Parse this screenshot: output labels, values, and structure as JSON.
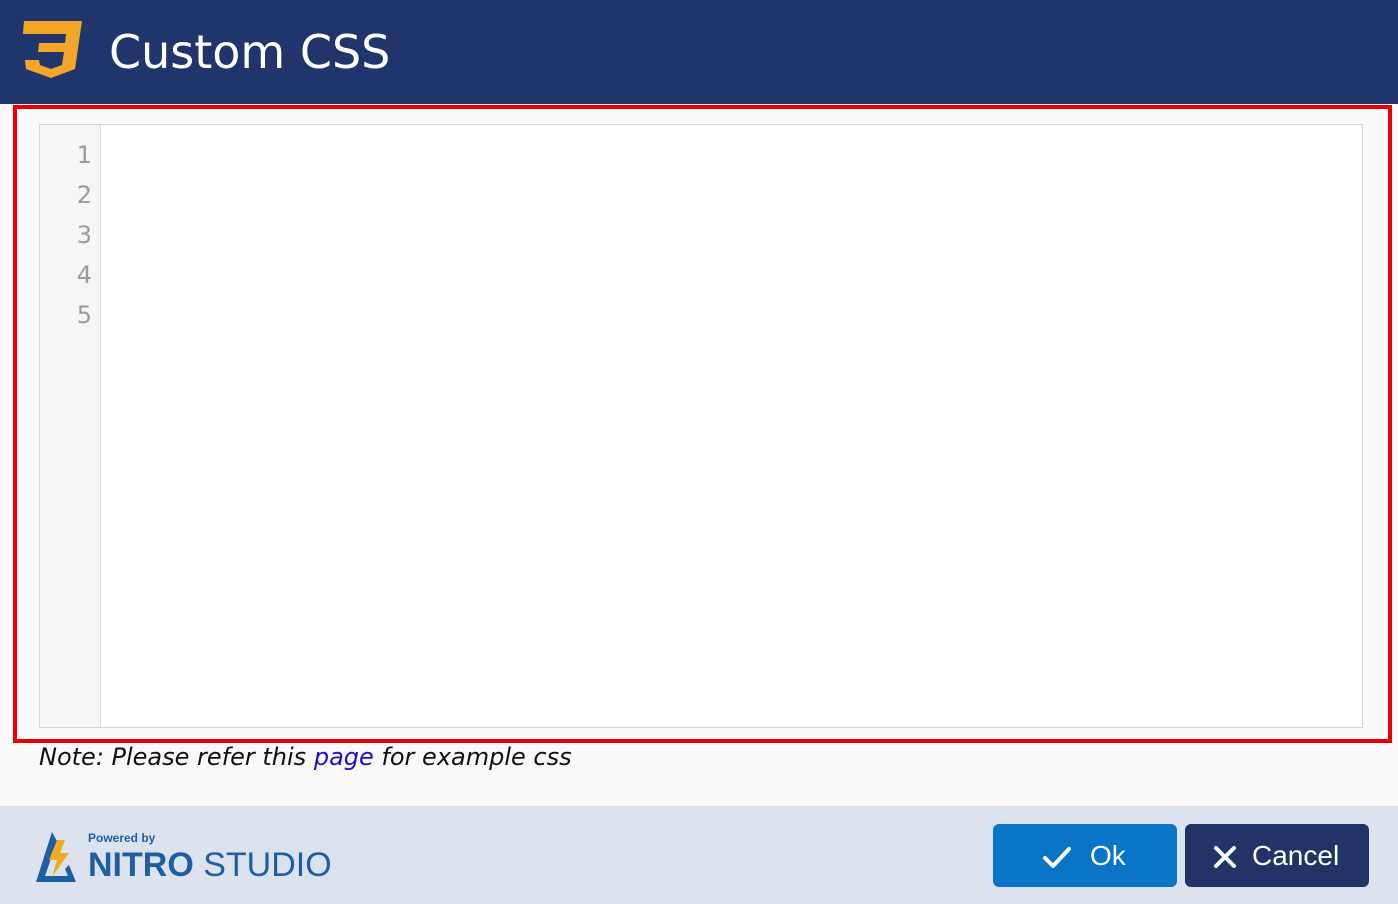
{
  "dialog": {
    "title": "Custom CSS",
    "icon": "css3-icon"
  },
  "editor": {
    "line_numbers": [
      "1",
      "2",
      "3",
      "4",
      "5"
    ],
    "content": ""
  },
  "note": {
    "prefix": "Note: Please refer this",
    "link_text": "page",
    "suffix": "for example css"
  },
  "footer": {
    "powered_by": "Powered by",
    "brand_bold": "NITRO",
    "brand_light": "STUDIO",
    "ok_label": "Ok",
    "cancel_label": "Cancel"
  },
  "colors": {
    "header_bg": "#20356b",
    "highlight_border": "#ee0000",
    "ok_button": "#0a74c6",
    "cancel_button": "#203468",
    "footer_bg": "#dce2ee",
    "link": "#1a0dcc",
    "css_logo": "#f2a72a"
  }
}
